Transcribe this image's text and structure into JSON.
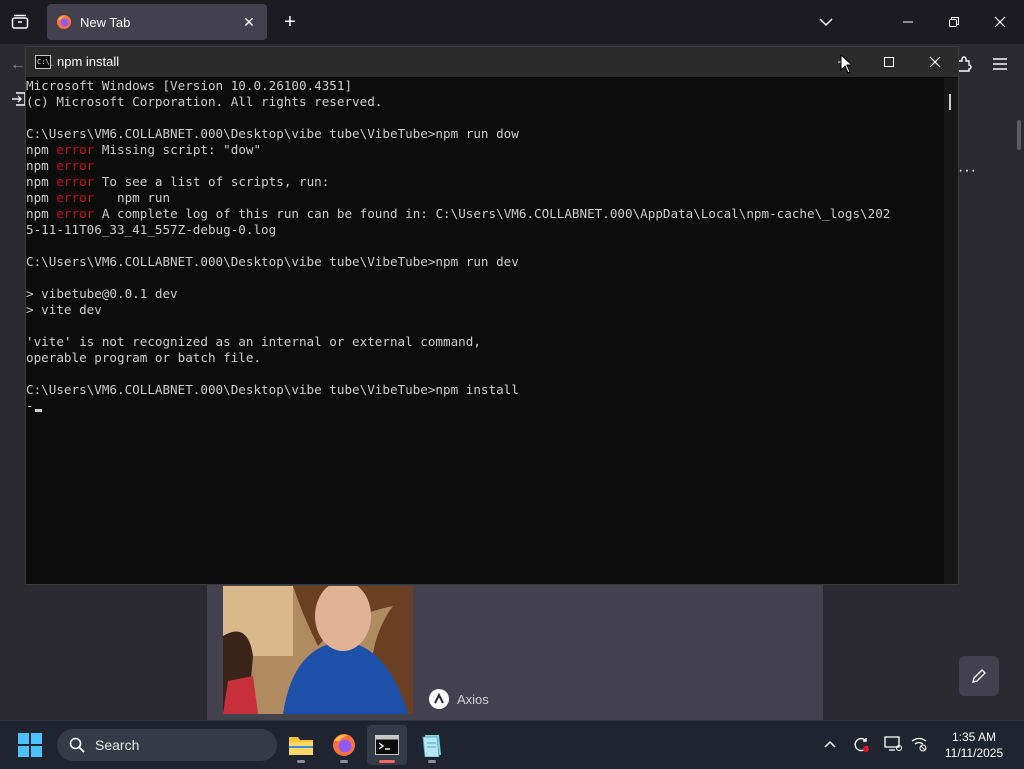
{
  "firefox": {
    "tab_title": "New Tab",
    "new_tab_symbol": "+",
    "close_tab_symbol": "✕"
  },
  "newtab": {
    "story_source": "Axios",
    "menu_dots": "···"
  },
  "cmd": {
    "title": "npm install",
    "icon_text": "C:\\_",
    "lines": [
      [
        {
          "t": "Microsoft Windows [Version 10.0.26100.4351]"
        }
      ],
      [
        {
          "t": "(c) Microsoft Corporation. All rights reserved."
        }
      ],
      [],
      [
        {
          "t": "C:\\Users\\VM6.COLLABNET.000\\Desktop\\vibe tube\\VibeTube>npm run dow"
        }
      ],
      [
        {
          "t": "npm "
        },
        {
          "t": "error",
          "e": true
        },
        {
          "t": " Missing script: \"dow\""
        }
      ],
      [
        {
          "t": "npm "
        },
        {
          "t": "error",
          "e": true
        }
      ],
      [
        {
          "t": "npm "
        },
        {
          "t": "error",
          "e": true
        },
        {
          "t": " To see a list of scripts, run:"
        }
      ],
      [
        {
          "t": "npm "
        },
        {
          "t": "error",
          "e": true
        },
        {
          "t": "   npm run"
        }
      ],
      [
        {
          "t": "npm "
        },
        {
          "t": "error",
          "e": true
        },
        {
          "t": " A complete log of this run can be found in: C:\\Users\\VM6.COLLABNET.000\\AppData\\Local\\npm-cache\\_logs\\202"
        }
      ],
      [
        {
          "t": "5-11-11T06_33_41_557Z-debug-0.log"
        }
      ],
      [],
      [
        {
          "t": "C:\\Users\\VM6.COLLABNET.000\\Desktop\\vibe tube\\VibeTube>npm run dev"
        }
      ],
      [],
      [
        {
          "t": "> vibetube@0.0.1 dev"
        }
      ],
      [
        {
          "t": "> vite dev"
        }
      ],
      [],
      [
        {
          "t": "'vite' is not recognized as an internal or external command,"
        }
      ],
      [
        {
          "t": "operable program or batch file."
        }
      ],
      [],
      [
        {
          "t": "C:\\Users\\VM6.COLLABNET.000\\Desktop\\vibe tube\\VibeTube>npm install"
        }
      ],
      [
        {
          "t": "-"
        }
      ]
    ]
  },
  "taskbar": {
    "search_label": "Search",
    "time": "1:35 AM",
    "date": "11/11/2025"
  },
  "colors": {
    "error": "#c50f1f",
    "accent_blue": "#4cc2ff",
    "firefox_orange": "#ff7139"
  }
}
